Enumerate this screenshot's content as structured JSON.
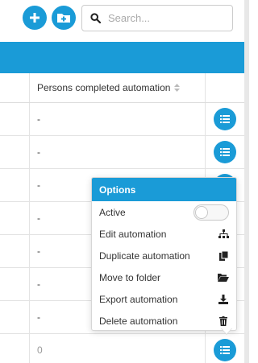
{
  "toolbar": {
    "search_placeholder": "Search..."
  },
  "table": {
    "column_header": "Persons completed automation",
    "rows": [
      {
        "value": "-"
      },
      {
        "value": "-"
      },
      {
        "value": "-"
      },
      {
        "value": "-"
      },
      {
        "value": "-"
      },
      {
        "value": "-"
      },
      {
        "value": "-"
      },
      {
        "value": "0"
      }
    ]
  },
  "options_menu": {
    "title": "Options",
    "active_label": "Active",
    "active_state": false,
    "items": [
      {
        "label": "Edit automation",
        "icon": "sitemap-icon"
      },
      {
        "label": "Duplicate automation",
        "icon": "copy-icon"
      },
      {
        "label": "Move to folder",
        "icon": "folder-open-icon"
      },
      {
        "label": "Export automation",
        "icon": "download-icon"
      },
      {
        "label": "Delete automation",
        "icon": "trash-icon"
      }
    ]
  },
  "colors": {
    "accent": "#1a9bd7"
  }
}
